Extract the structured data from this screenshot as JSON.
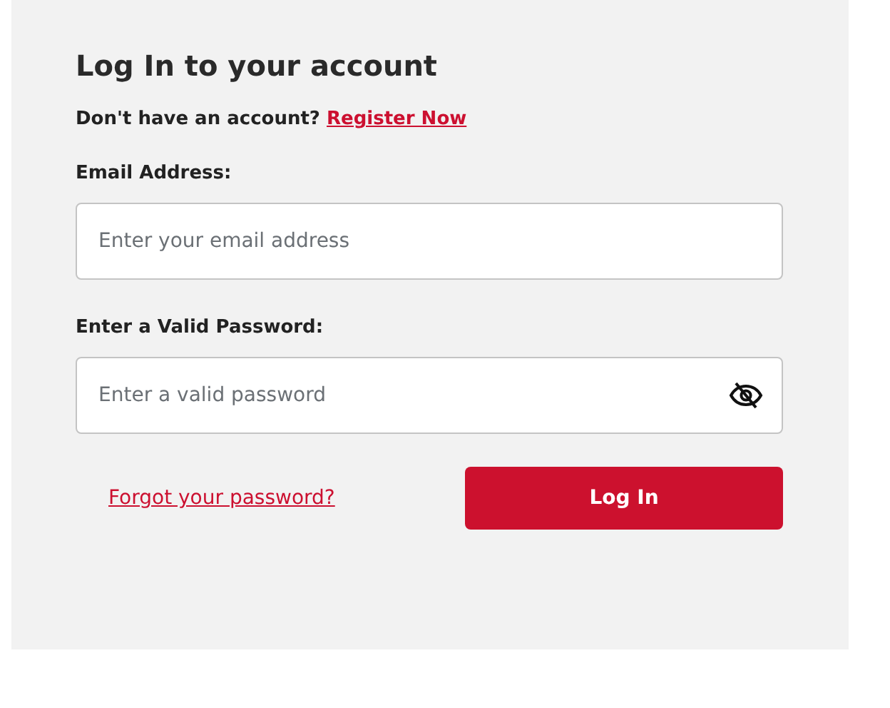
{
  "title": "Log In to your account",
  "register_prompt": {
    "text": "Don't have an account?",
    "link": "Register Now"
  },
  "email": {
    "label": "Email Address:",
    "placeholder": "Enter your email address"
  },
  "password": {
    "label": "Enter a Valid Password:",
    "placeholder": "Enter a valid password",
    "visible": false
  },
  "forgot_link": "Forgot your password?",
  "submit_button": "Log In"
}
